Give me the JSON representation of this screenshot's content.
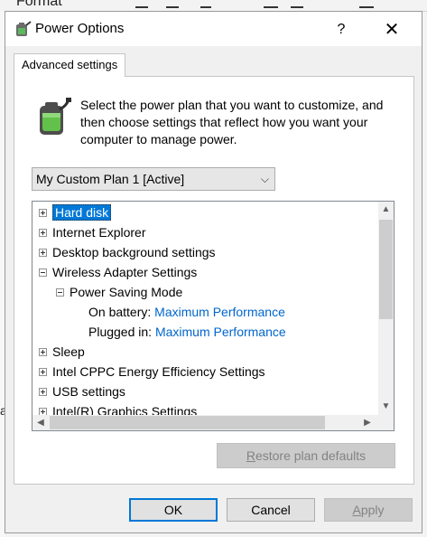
{
  "background": {
    "format_label": "Format",
    "left_fragment": "a"
  },
  "dialog": {
    "title": "Power Options",
    "help_glyph": "?",
    "close_glyph": "✕"
  },
  "tab": {
    "label": "Advanced settings"
  },
  "description": "Select the power plan that you want to customize, and then choose settings that reflect how you want your computer to manage power.",
  "plan_select": {
    "value": "My Custom Plan 1 [Active]",
    "chevron": "⌵"
  },
  "tree": {
    "items": [
      {
        "label": "Hard disk",
        "expander": "plus"
      },
      {
        "label": "Internet Explorer",
        "expander": "plus"
      },
      {
        "label": "Desktop background settings",
        "expander": "plus"
      },
      {
        "label": "Wireless Adapter Settings",
        "expander": "minus"
      },
      {
        "label": "Power Saving Mode",
        "expander": "minus"
      },
      {
        "label": "On battery:",
        "value": "Maximum Performance"
      },
      {
        "label": "Plugged in:",
        "value": "Maximum Performance"
      },
      {
        "label": "Sleep",
        "expander": "plus"
      },
      {
        "label": "Intel CPPC Energy Efficiency Settings",
        "expander": "plus"
      },
      {
        "label": "USB settings",
        "expander": "plus"
      },
      {
        "label": "Intel(R) Graphics Settings",
        "expander": "plus"
      }
    ]
  },
  "buttons": {
    "restore_prefix": "R",
    "restore_rest": "estore plan defaults",
    "ok": "OK",
    "cancel": "Cancel",
    "apply_prefix": "A",
    "apply_rest": "pply"
  },
  "icons": {
    "title": "power-options-icon",
    "battery": "battery-plug-icon"
  },
  "colors": {
    "selection": "#0078d7",
    "link": "#0066cc",
    "default_button_border": "#0078d7"
  }
}
